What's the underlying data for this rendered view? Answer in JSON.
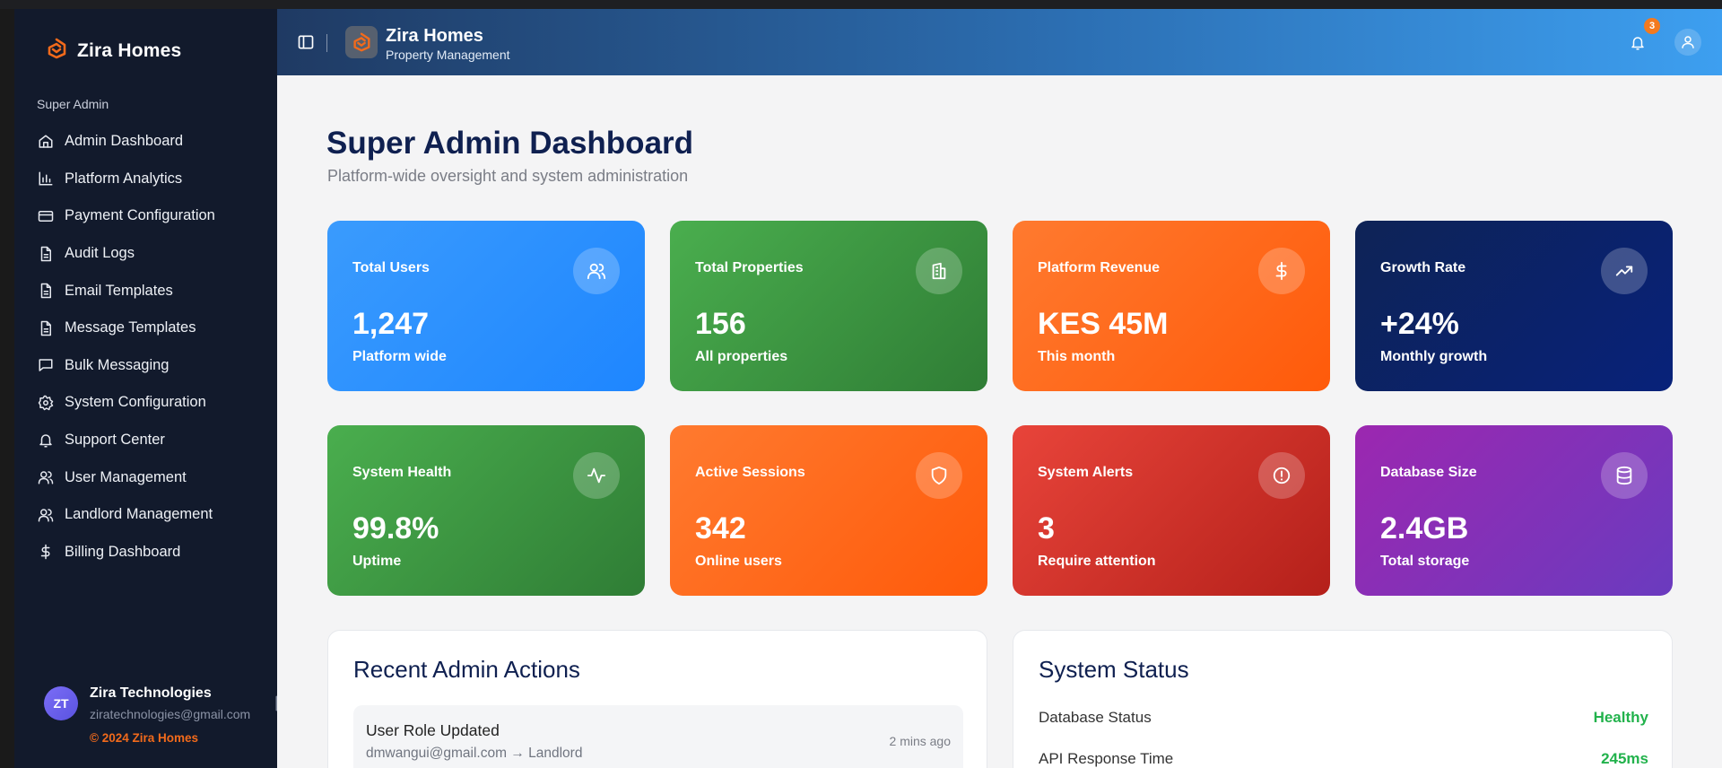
{
  "brand": {
    "name": "Zira Homes"
  },
  "sidebar": {
    "section_label": "Super Admin",
    "items": [
      {
        "label": "Admin Dashboard",
        "icon": "home-icon"
      },
      {
        "label": "Platform Analytics",
        "icon": "bar-chart-icon"
      },
      {
        "label": "Payment Configuration",
        "icon": "credit-card-icon"
      },
      {
        "label": "Audit Logs",
        "icon": "document-icon"
      },
      {
        "label": "Email Templates",
        "icon": "document-icon"
      },
      {
        "label": "Message Templates",
        "icon": "document-icon"
      },
      {
        "label": "Bulk Messaging",
        "icon": "message-square-icon"
      },
      {
        "label": "System Configuration",
        "icon": "gear-icon"
      },
      {
        "label": "Support Center",
        "icon": "bell-icon"
      },
      {
        "label": "User Management",
        "icon": "users-icon"
      },
      {
        "label": "Landlord Management",
        "icon": "users-icon"
      },
      {
        "label": "Billing Dashboard",
        "icon": "dollar-icon"
      }
    ],
    "user": {
      "initials": "ZT",
      "name": "Zira Technologies",
      "email": "ziratechnologies@gmail.com",
      "copyright": "© 2024 Zira Homes"
    }
  },
  "header": {
    "title": "Zira Homes",
    "subtitle": "Property Management",
    "notification_count": "3"
  },
  "main": {
    "title": "Super Admin Dashboard",
    "subtitle": "Platform-wide oversight and system administration",
    "stats": [
      {
        "label": "Total Users",
        "value": "1,247",
        "sub": "Platform wide",
        "icon": "users-icon"
      },
      {
        "label": "Total Properties",
        "value": "156",
        "sub": "All properties",
        "icon": "building-icon"
      },
      {
        "label": "Platform Revenue",
        "value": "KES 45M",
        "sub": "This month",
        "icon": "dollar-icon"
      },
      {
        "label": "Growth Rate",
        "value": "+24%",
        "sub": "Monthly growth",
        "icon": "trending-up-icon"
      },
      {
        "label": "System Health",
        "value": "99.8%",
        "sub": "Uptime",
        "icon": "activity-icon"
      },
      {
        "label": "Active Sessions",
        "value": "342",
        "sub": "Online users",
        "icon": "shield-icon"
      },
      {
        "label": "System Alerts",
        "value": "3",
        "sub": "Require attention",
        "icon": "alert-circle-icon"
      },
      {
        "label": "Database Size",
        "value": "2.4GB",
        "sub": "Total storage",
        "icon": "database-icon"
      }
    ],
    "recent_actions": {
      "title": "Recent Admin Actions",
      "items": [
        {
          "title": "User Role Updated",
          "detail": "dmwangui@gmail.com → Landlord",
          "time": "2 mins ago"
        }
      ]
    },
    "system_status": {
      "title": "System Status",
      "items": [
        {
          "label": "Database Status",
          "value": "Healthy"
        },
        {
          "label": "API Response Time",
          "value": "245ms"
        }
      ]
    }
  },
  "colors": {
    "accent": "#f26a1b",
    "navy": "#0f2050",
    "success": "#22b24c",
    "sidebar_bg": "#121a2c"
  }
}
